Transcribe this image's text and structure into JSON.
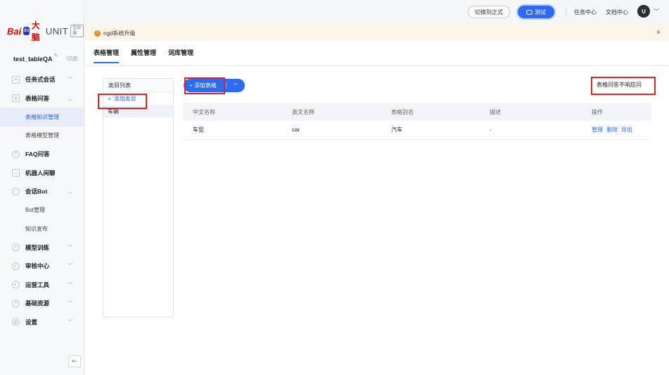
{
  "brand": {
    "logo_bai": "Bai",
    "logo_paw": "du",
    "logo_daname": "大脑",
    "logo_unit": "UNIT",
    "logo_badge": "企业版"
  },
  "project": {
    "name": "test_tableQA",
    "switch_label": "切换"
  },
  "sidebar": {
    "items": [
      {
        "label": "任务式会话",
        "icon": "robot-icon",
        "expanded": false
      },
      {
        "label": "表格问答",
        "icon": "table-icon",
        "expanded": true
      },
      {
        "label": "表格知识管理"
      },
      {
        "label": "表格模型管理"
      },
      {
        "label": "FAQ问答",
        "icon": "question-icon"
      },
      {
        "label": "机器人闲聊",
        "icon": "chat-icon"
      },
      {
        "label": "会话Bot",
        "icon": "bot-icon",
        "expanded": true
      },
      {
        "label": "Bot管理"
      },
      {
        "label": "知识发布"
      },
      {
        "label": "模型训练",
        "icon": "train-icon",
        "expanded": false
      },
      {
        "label": "审核中心",
        "icon": "check-icon",
        "expanded": false
      },
      {
        "label": "运营工具",
        "icon": "tool-icon",
        "expanded": false
      },
      {
        "label": "基础资源",
        "icon": "resource-icon",
        "expanded": false
      },
      {
        "label": "设置",
        "icon": "settings-icon",
        "expanded": false
      }
    ],
    "active_item": "表格知识管理"
  },
  "topbar": {
    "switch_label": "切换到正式",
    "test_label": "测试",
    "task_center": "任务中心",
    "doc_center": "文档中心",
    "avatar_letter": "U"
  },
  "notice": {
    "text": "ngd系统升级",
    "close": "×"
  },
  "tabs": [
    "表格管理",
    "属性管理",
    "词库管理"
  ],
  "active_tab": "表格管理",
  "category": {
    "title": "类目列表",
    "add_label": "添加类目",
    "items": [
      "车辆"
    ]
  },
  "toolbar": {
    "add_table": "添加表格",
    "no_response": "表格问答不响应问"
  },
  "table": {
    "headers": [
      "中文名称",
      "英文名称",
      "表格别名",
      "描述",
      "操作"
    ],
    "rows": [
      {
        "cn": "车型",
        "en": "car",
        "alias": "汽车",
        "desc": "-",
        "ops": [
          "管理",
          "删除",
          "导出"
        ]
      }
    ]
  },
  "colors": {
    "accent": "#2f6bf2",
    "highlight": "#d7271f",
    "notice_bg": "#fdf6e8",
    "notice_icon": "#f28b1e"
  }
}
